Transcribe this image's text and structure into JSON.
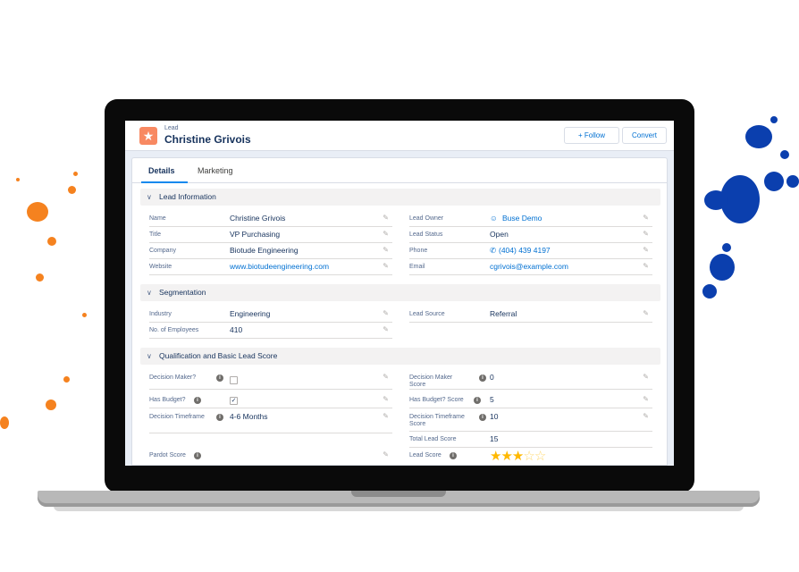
{
  "record": {
    "object_label": "Lead",
    "name": "Christine Grivois",
    "follow_label": "+ Follow",
    "convert_label": "Convert"
  },
  "tabs": [
    "Details",
    "Marketing"
  ],
  "sections": {
    "lead_info": "Lead Information",
    "segmentation": "Segmentation",
    "qualification": "Qualification and Basic Lead Score"
  },
  "lead_info": {
    "left": [
      {
        "label": "Name",
        "value": "Christine Grivois"
      },
      {
        "label": "Title",
        "value": "VP Purchasing"
      },
      {
        "label": "Company",
        "value": "Biotude Engineering"
      },
      {
        "label": "Website",
        "value": "www.biotudeengineering.com"
      }
    ],
    "right": [
      {
        "label": "Lead Owner",
        "value": "Buse Demo"
      },
      {
        "label": "Lead Status",
        "value": "Open"
      },
      {
        "label": "Phone",
        "value": "(404) 439 4197"
      },
      {
        "label": "Email",
        "value": "cgrivois@example.com"
      }
    ]
  },
  "segmentation": {
    "industry_label": "Industry",
    "industry": "Engineering",
    "employees_label": "No. of Employees",
    "employees": "410",
    "source_label": "Lead Source",
    "source": "Referral"
  },
  "qualification": {
    "decision_maker_label": "Decision Maker?",
    "decision_maker": false,
    "has_budget_label": "Has Budget?",
    "has_budget": true,
    "timeframe_label": "Decision Timeframe",
    "timeframe": "4-6 Months",
    "pardot_label": "Pardot Score",
    "dm_score_label": "Decision Maker Score",
    "dm_score": "0",
    "budget_score_label": "Has Budget? Score",
    "budget_score": "5",
    "timeframe_score_label": "Decision Timeframe Score",
    "timeframe_score": "10",
    "total_label": "Total Lead Score",
    "total": "15",
    "lead_score_label": "Lead Score",
    "lead_score_stars": 3,
    "lead_score_max": 5
  },
  "icons": {
    "lead": "star-icon",
    "edit": "pencil-icon",
    "info": "info-icon",
    "owner": "user-icon",
    "phone": "phone-icon",
    "collapse": "chevron-down-icon"
  },
  "colors": {
    "brand_link": "#0070d2",
    "lead_icon": "#f88962",
    "splatter_orange": "#f5821f",
    "splatter_blue": "#0b3fae",
    "star": "#ffb800"
  }
}
